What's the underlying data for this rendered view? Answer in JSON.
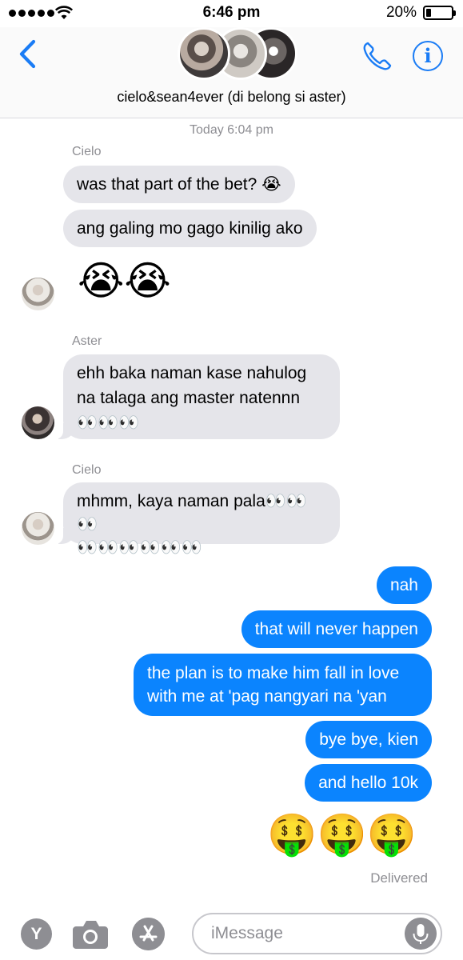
{
  "status_bar": {
    "time": "6:46 pm",
    "battery_percent": "20%",
    "battery_level": 0.2,
    "signal_bars": 5
  },
  "header": {
    "group_name": "cielo&sean4ever (di belong si aster)",
    "back_icon": "chevron-left-icon",
    "call_icon": "phone-icon",
    "info_icon": "info-icon",
    "info_glyph": "i",
    "accent_color": "#1a7cf5"
  },
  "conversation": {
    "timestamp": "Today 6:04 pm",
    "groups": [
      {
        "sender": "Cielo",
        "messages": [
          "was that part of the bet? 😭",
          "ang galing mo gago kinilig ako"
        ],
        "emoji": "😭😭"
      },
      {
        "sender": "Aster",
        "messages": [
          "ehh baka naman kase nahulog",
          "na talaga ang master natennn",
          "👀👀👀"
        ]
      },
      {
        "sender": "Cielo",
        "messages": [
          "mhmm, kaya naman pala👀👀👀",
          "👀👀👀👀👀👀"
        ]
      }
    ],
    "outgoing": [
      "nah",
      "that will never happen",
      "the plan is to make him fall in love",
      "with me at 'pag nangyari na 'yan",
      "bye bye, kien",
      "and hello 10k"
    ],
    "outgoing_emoji": "🤑🤑🤑",
    "delivered": "Delivered",
    "incoming_color": "#e5e5ea",
    "outgoing_color": "#0b84fe"
  },
  "input_bar": {
    "y_label": "Y",
    "placeholder": "iMessage",
    "value": "",
    "camera_icon": "camera-icon",
    "appstore_icon": "app-store-icon",
    "mic_icon": "microphone-icon"
  }
}
